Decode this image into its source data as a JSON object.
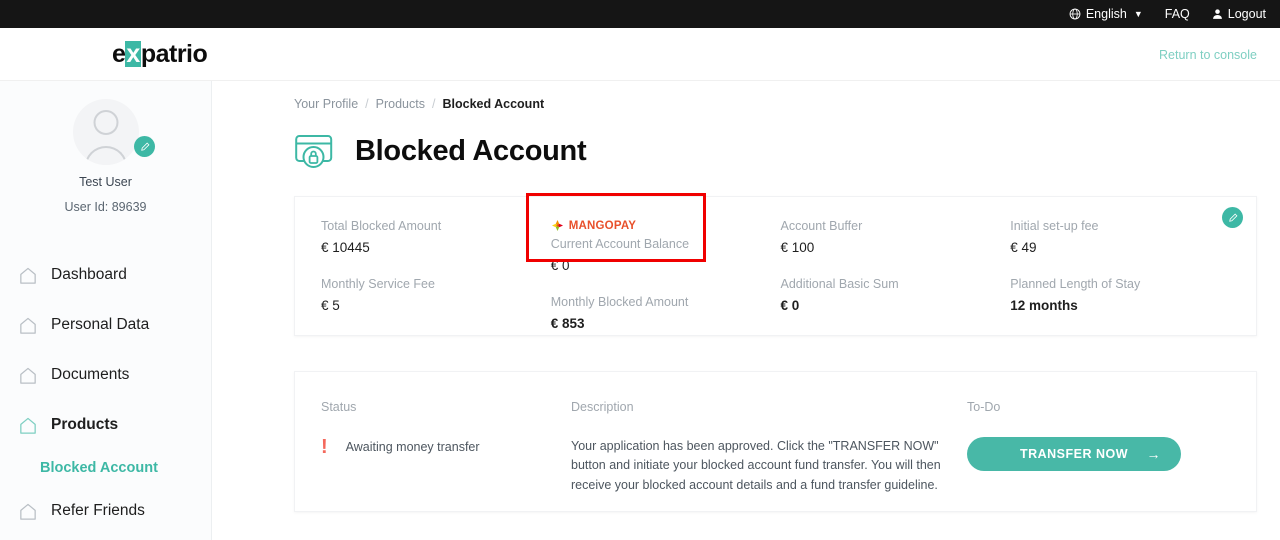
{
  "topbar": {
    "language": "English",
    "faq": "FAQ",
    "logout": "Logout",
    "globe_icon": "globe-icon",
    "chevron_icon": "chevron-down-icon",
    "user_icon": "user-icon"
  },
  "header": {
    "logo_pre": "e",
    "logo_x": "x",
    "logo_post": "patrio",
    "return_to_console": "Return to console"
  },
  "sidebar": {
    "user_name": "Test User",
    "user_id": "User Id: 89639",
    "edit_badge_icon": "pencil-icon",
    "items": [
      {
        "label": "Dashboard",
        "icon": "house-icon",
        "active": false
      },
      {
        "label": "Personal Data",
        "icon": "house-icon",
        "active": false
      },
      {
        "label": "Documents",
        "icon": "house-icon",
        "active": false
      },
      {
        "label": "Products",
        "icon": "house-icon",
        "active": true
      },
      {
        "label": "Refer Friends",
        "icon": "house-icon",
        "active": false
      }
    ],
    "sub_item": "Blocked Account"
  },
  "main": {
    "breadcrumb": {
      "first": "Your Profile",
      "sep1": "/",
      "second": "Products",
      "sep2": "/",
      "current": "Blocked Account"
    },
    "page_title": "Blocked Account",
    "page_title_icon": "blocked-card-icon",
    "stats": {
      "edit_badge_icon": "pencil-icon",
      "brand": "MANGOPAY",
      "brand_icon": "mangopay-diamond-icon",
      "items": [
        {
          "label": "Total Blocked Amount",
          "value": "€ 10445",
          "bold": false
        },
        {
          "label": "Current Account Balance",
          "value": "€ 0",
          "bold": false
        },
        {
          "label": "Account Buffer",
          "value": "€ 100",
          "bold": false
        },
        {
          "label": "Initial set-up fee",
          "value": "€ 49",
          "bold": false
        },
        {
          "label": "Monthly Service Fee",
          "value": "€ 5",
          "bold": false
        },
        {
          "label": "Monthly Blocked Amount",
          "value": "€ 853",
          "bold": true
        },
        {
          "label": "Additional Basic Sum",
          "value": "€ 0",
          "bold": true
        },
        {
          "label": "Planned Length of Stay",
          "value": "12 months",
          "bold": true
        }
      ]
    },
    "status_card": {
      "status_head": "Status",
      "status_icon": "alert-exclamation-icon",
      "status_text": "Awaiting money transfer",
      "description_head": "Description",
      "description_text": "Your application has been approved. Click the \"TRANSFER NOW\" button and initiate your blocked account fund transfer. You will then receive your blocked account details and a fund transfer guideline.",
      "todo_head": "To-Do",
      "todo_button": "TRANSFER NOW",
      "todo_button_icon": "arrow-right-icon"
    }
  },
  "colors": {
    "accent_teal": "#3db8a5",
    "button_teal": "#48b8a7",
    "brand_orange": "#e8502b",
    "alert_red": "#f4685c",
    "highlight_red": "#f00000",
    "topbar_black": "#151515"
  }
}
